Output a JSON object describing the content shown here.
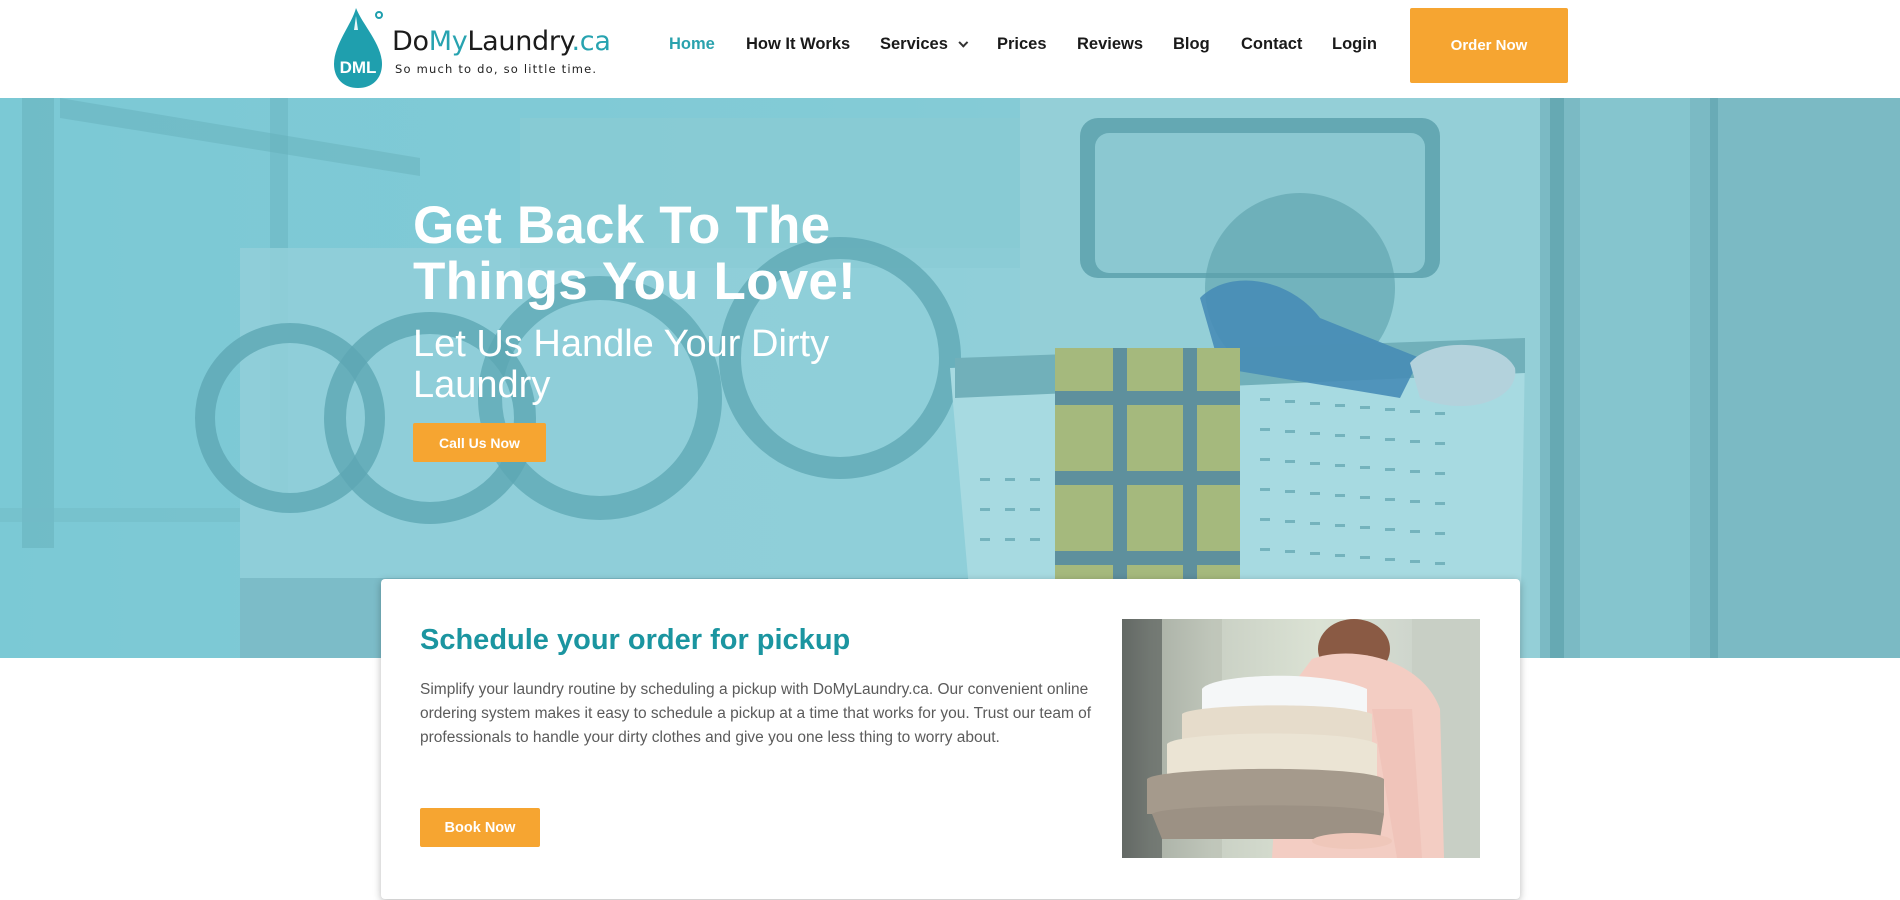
{
  "brand": {
    "name_prefix": "Do",
    "name_accent": "My",
    "name_main": "Laundry",
    "name_suffix": ".ca",
    "tagline": "So much to do, so little time.",
    "logo_mark": "DML",
    "accent_color": "#27a3b0",
    "cta_color": "#f6a531"
  },
  "nav": {
    "items": [
      {
        "label": "Home",
        "active": true
      },
      {
        "label": "How It Works",
        "active": false
      },
      {
        "label": "Services",
        "active": false,
        "has_dropdown": true
      },
      {
        "label": "Prices",
        "active": false
      },
      {
        "label": "Reviews",
        "active": false
      },
      {
        "label": "Blog",
        "active": false
      },
      {
        "label": "Contact",
        "active": false
      },
      {
        "label": "Login",
        "active": false
      }
    ],
    "cta_label": "Order Now"
  },
  "hero": {
    "title": "Get Back To The Things You Love!",
    "subtitle": "Let Us Handle Your Dirty Laundry",
    "cta_label": "Call Us Now"
  },
  "schedule": {
    "title": "Schedule your order for pickup",
    "body": "Simplify your laundry routine by scheduling a pickup with DoMyLaundry.ca. Our convenient online ordering system makes it easy to schedule a pickup at a time that works for you. Trust our team of professionals to handle your dirty clothes and give you one less thing to worry about.",
    "cta_label": "Book Now",
    "image_alt": "Person holding a stack of folded towels"
  }
}
